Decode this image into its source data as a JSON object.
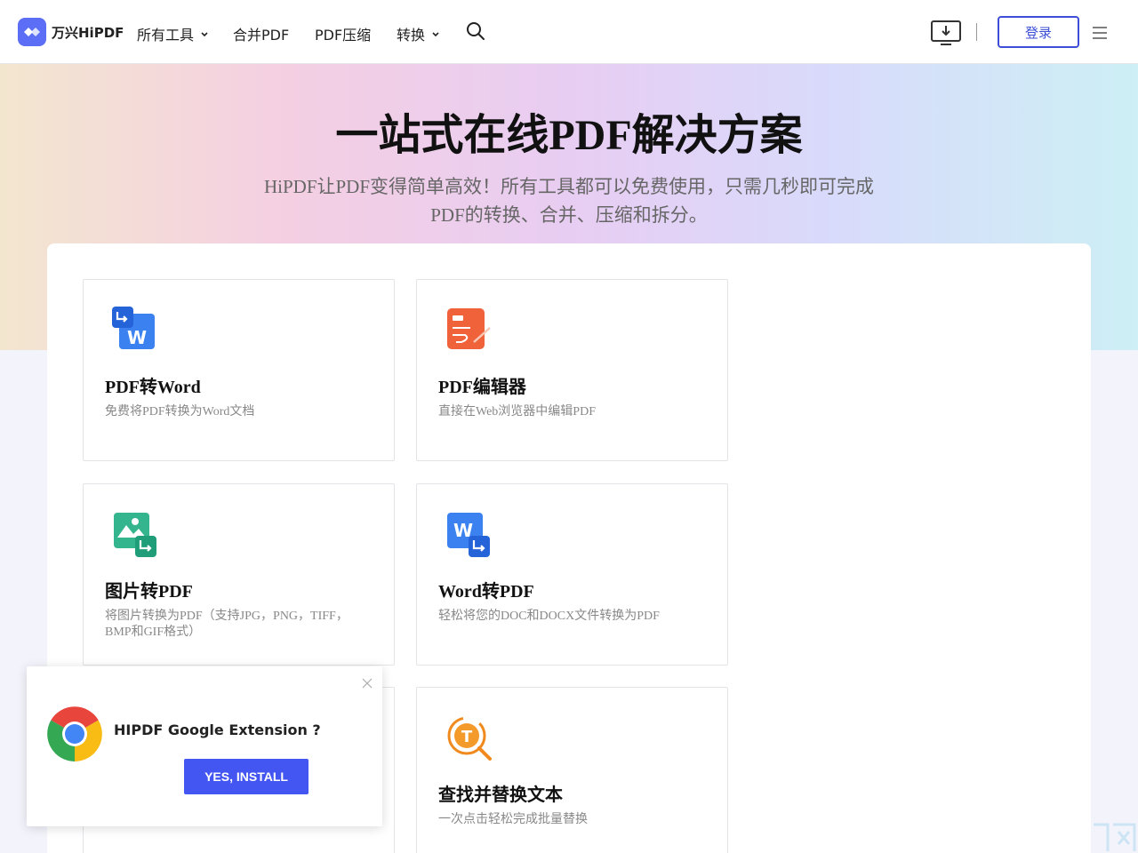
{
  "header": {
    "brand": "万兴HiPDF",
    "nav": [
      {
        "label": "所有工具",
        "dropdown": true
      },
      {
        "label": "合并PDF",
        "dropdown": false
      },
      {
        "label": "PDF压缩",
        "dropdown": false
      },
      {
        "label": "转换",
        "dropdown": true
      }
    ],
    "login_label": "登录",
    "accent": "#3d4fd6"
  },
  "hero": {
    "title": "一站式在线PDF解决方案",
    "subtitle_line1": "HiPDF让PDF变得简单高效！所有工具都可以免费使用，只需几秒即可完成",
    "subtitle_line2": "PDF的转换、合并、压缩和拆分。"
  },
  "tools": [
    {
      "icon": "pdf-to-word-icon",
      "title": "PDF转Word",
      "desc": "免费将PDF转换为Word文档"
    },
    {
      "icon": "pdf-editor-icon",
      "title": "PDF编辑器",
      "desc": "直接在Web浏览器中编辑PDF"
    },
    {
      "icon": "image-to-pdf-icon",
      "title": "图片转PDF",
      "desc": "将图片转换为PDF（支持JPG，PNG，TIFF，BMP和GIF格式）"
    },
    {
      "icon": "word-to-pdf-icon",
      "title": "Word转PDF",
      "desc": "轻松将您的DOC和DOCX文件转换为PDF"
    },
    {
      "icon": "find-replace-icon",
      "title": "查找并替换文本",
      "desc": "一次点击轻松完成批量替换"
    }
  ],
  "popup": {
    "question": "HIPDF Google Extension ?",
    "install_label": "YES, INSTALL"
  }
}
